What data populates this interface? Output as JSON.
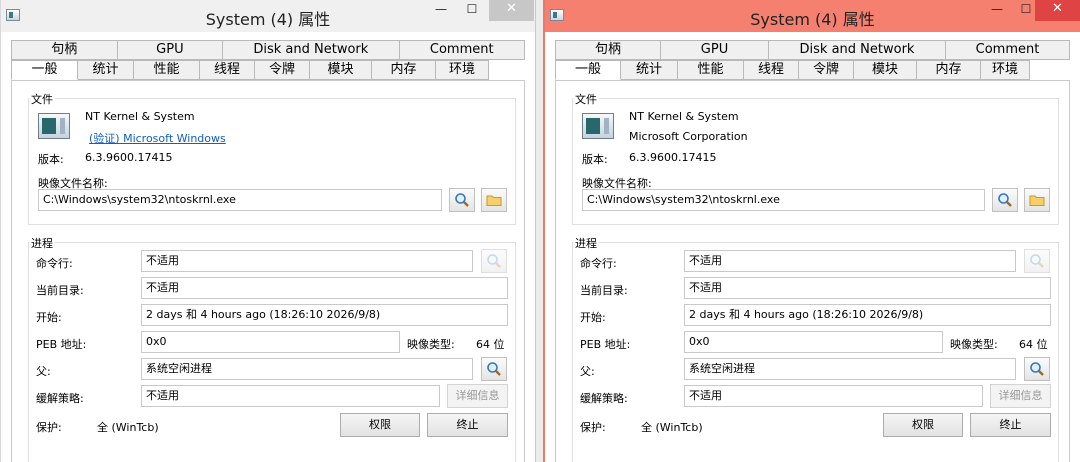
{
  "windows": [
    {
      "title": "System (4) 属性",
      "tabs_row1": [
        "句柄",
        "GPU",
        "Disk and Network",
        "Comment"
      ],
      "tabs_row2": [
        "一般",
        "统计",
        "性能",
        "线程",
        "令牌",
        "模块",
        "内存",
        "环境"
      ],
      "file_group_label": "文件",
      "file_name": "NT Kernel & System",
      "company": "(验证) Microsoft Windows",
      "version_label": "版本:",
      "version": "6.3.9600.17415",
      "image_file_label": "映像文件名称:",
      "image_path": "C:\\Windows\\system32\\ntoskrnl.exe",
      "process_group_label": "进程",
      "cmdline_label": "命令行:",
      "cmdline": "不适用",
      "cwd_label": "当前目录:",
      "cwd": "不适用",
      "start_label": "开始:",
      "start": "2 days 和 4 hours ago (18:26:10 2026/9/8)",
      "peb_label": "PEB 地址:",
      "peb": "0x0",
      "image_type_label": "映像类型:",
      "image_type": "64 位",
      "parent_label": "父:",
      "parent": "系统空闲进程",
      "mitigation_label": "缓解策略:",
      "mitigation": "不适用",
      "details_button": "详细信息",
      "protection_label": "保护:",
      "protection": "全 (WinTcb)",
      "permissions_button": "权限",
      "terminate_button": "终止"
    },
    {
      "title": "System (4) 属性",
      "tabs_row1": [
        "句柄",
        "GPU",
        "Disk and Network",
        "Comment"
      ],
      "tabs_row2": [
        "一般",
        "统计",
        "性能",
        "线程",
        "令牌",
        "模块",
        "内存",
        "环境"
      ],
      "file_group_label": "文件",
      "file_name": "NT Kernel & System",
      "company": "Microsoft Corporation",
      "version_label": "版本:",
      "version": "6.3.9600.17415",
      "image_file_label": "映像文件名称:",
      "image_path": "C:\\Windows\\system32\\ntoskrnl.exe",
      "process_group_label": "进程",
      "cmdline_label": "命令行:",
      "cmdline": "不适用",
      "cwd_label": "当前目录:",
      "cwd": "不适用",
      "start_label": "开始:",
      "start": "2 days 和 4 hours ago (18:26:10 2026/9/8)",
      "peb_label": "PEB 地址:",
      "peb": "0x0",
      "image_type_label": "映像类型:",
      "image_type": "64 位",
      "parent_label": "父:",
      "parent": "系统空闲进程",
      "mitigation_label": "缓解策略:",
      "mitigation": "不适用",
      "details_button": "详细信息",
      "protection_label": "保护:",
      "protection": "全 (WinTcb)",
      "permissions_button": "权限",
      "terminate_button": "终止"
    }
  ],
  "colors": {
    "active_titlebar": "#f5806f",
    "close_button": "#e04343",
    "link": "#1060c0"
  },
  "icons": [
    "window-icon",
    "minimize-icon",
    "maximize-icon",
    "close-icon",
    "app-icon",
    "search-icon",
    "folder-icon"
  ]
}
